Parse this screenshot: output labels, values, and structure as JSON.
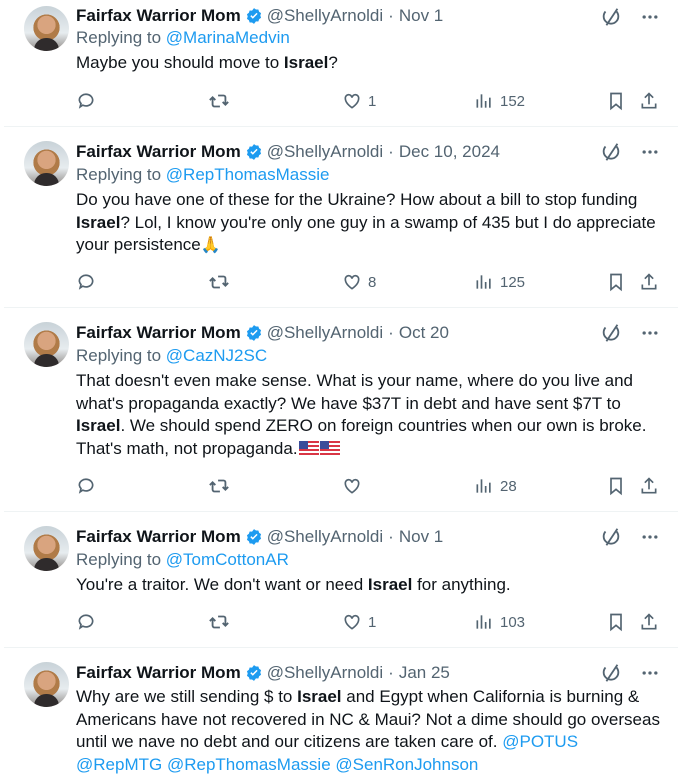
{
  "colors": {
    "accent": "#1d9bf0",
    "muted": "#536471",
    "text": "#0f1419",
    "divider": "#eff3f4"
  },
  "tweets": [
    {
      "name": "Fairfax Warrior Mom",
      "handle": "@ShellyArnoldi",
      "date": "Nov 1",
      "replying_prefix": "Replying to ",
      "replying_to": "@MarinaMedvin",
      "text": [
        "Maybe you should move to ",
        "Israel",
        "?"
      ],
      "replies": "",
      "retweets": "",
      "likes": "1",
      "views": "152"
    },
    {
      "name": "Fairfax Warrior Mom",
      "handle": "@ShellyArnoldi",
      "date": "Dec 10, 2024",
      "replying_prefix": "Replying to ",
      "replying_to": "@RepThomasMassie",
      "text": [
        "Do you have one of these for the Ukraine? How about a bill to stop funding ",
        "Israel",
        "? Lol, I know you're only one guy in a swamp of 435 but I do appreciate your persistence"
      ],
      "emoji": "folded-hands-emoji",
      "replies": "",
      "retweets": "",
      "likes": "8",
      "views": "125"
    },
    {
      "name": "Fairfax Warrior Mom",
      "handle": "@ShellyArnoldi",
      "date": "Oct 20",
      "replying_prefix": "Replying to ",
      "replying_to": "@CazNJ2SC",
      "text": [
        "That doesn't even make sense. What is your name, where do you live and what's propaganda exactly? We have $37T in debt and have sent $7T to ",
        "Israel",
        ". We should spend ZERO on foreign countries when our own is broke. That's math, not propaganda."
      ],
      "emoji": "us-flag-emoji",
      "replies": "",
      "retweets": "",
      "likes": "",
      "views": "28"
    },
    {
      "name": "Fairfax Warrior Mom",
      "handle": "@ShellyArnoldi",
      "date": "Nov 1",
      "replying_prefix": "Replying to ",
      "replying_to": "@TomCottonAR",
      "text": [
        "You're a traitor. We don't want or need ",
        "Israel",
        " for anything."
      ],
      "replies": "",
      "retweets": "",
      "likes": "1",
      "views": "103"
    },
    {
      "name": "Fairfax Warrior Mom",
      "handle": "@ShellyArnoldi",
      "date": "Jan 25",
      "text": [
        "Why are we still sending $ to ",
        "Israel",
        " and Egypt when California is burning & Americans have not recovered in NC & Maui? Not a dime should go overseas until we nave no debt and our citizens are taken care of. "
      ],
      "mentions": [
        "@POTUS",
        "@RepMTG",
        "@RepThomasMassie",
        "@SenRonJohnson"
      ]
    }
  ],
  "dot": "·"
}
